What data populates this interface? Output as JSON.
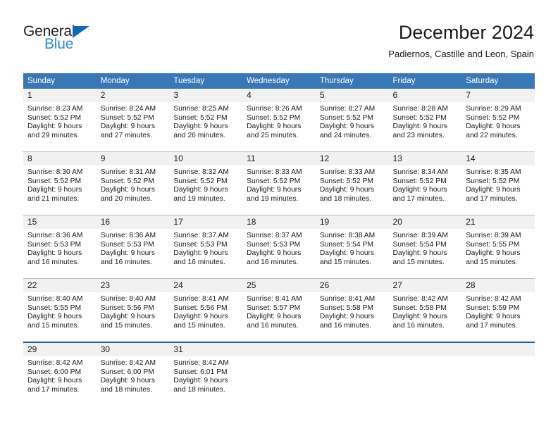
{
  "logo": {
    "word_top": "General",
    "word_bottom": "Blue",
    "triangle_color": "#1167b1",
    "blue_color": "#2e8bd0"
  },
  "header": {
    "title": "December 2024",
    "subtitle": "Padiernos, Castille and Leon, Spain"
  },
  "theme": {
    "header_bg": "#3a77b5",
    "daynum_bg": "#f1f1f1",
    "grid_line": "#bfbfbf",
    "accent_rule": "#1f6099"
  },
  "calendar": {
    "weekday_headers": [
      "Sunday",
      "Monday",
      "Tuesday",
      "Wednesday",
      "Thursday",
      "Friday",
      "Saturday"
    ],
    "weeks": [
      [
        {
          "day": "1",
          "sunrise": "Sunrise: 8:23 AM",
          "sunset": "Sunset: 5:52 PM",
          "daylight_line1": "Daylight: 9 hours",
          "daylight_line2": "and 29 minutes."
        },
        {
          "day": "2",
          "sunrise": "Sunrise: 8:24 AM",
          "sunset": "Sunset: 5:52 PM",
          "daylight_line1": "Daylight: 9 hours",
          "daylight_line2": "and 27 minutes."
        },
        {
          "day": "3",
          "sunrise": "Sunrise: 8:25 AM",
          "sunset": "Sunset: 5:52 PM",
          "daylight_line1": "Daylight: 9 hours",
          "daylight_line2": "and 26 minutes."
        },
        {
          "day": "4",
          "sunrise": "Sunrise: 8:26 AM",
          "sunset": "Sunset: 5:52 PM",
          "daylight_line1": "Daylight: 9 hours",
          "daylight_line2": "and 25 minutes."
        },
        {
          "day": "5",
          "sunrise": "Sunrise: 8:27 AM",
          "sunset": "Sunset: 5:52 PM",
          "daylight_line1": "Daylight: 9 hours",
          "daylight_line2": "and 24 minutes."
        },
        {
          "day": "6",
          "sunrise": "Sunrise: 8:28 AM",
          "sunset": "Sunset: 5:52 PM",
          "daylight_line1": "Daylight: 9 hours",
          "daylight_line2": "and 23 minutes."
        },
        {
          "day": "7",
          "sunrise": "Sunrise: 8:29 AM",
          "sunset": "Sunset: 5:52 PM",
          "daylight_line1": "Daylight: 9 hours",
          "daylight_line2": "and 22 minutes."
        }
      ],
      [
        {
          "day": "8",
          "sunrise": "Sunrise: 8:30 AM",
          "sunset": "Sunset: 5:52 PM",
          "daylight_line1": "Daylight: 9 hours",
          "daylight_line2": "and 21 minutes."
        },
        {
          "day": "9",
          "sunrise": "Sunrise: 8:31 AM",
          "sunset": "Sunset: 5:52 PM",
          "daylight_line1": "Daylight: 9 hours",
          "daylight_line2": "and 20 minutes."
        },
        {
          "day": "10",
          "sunrise": "Sunrise: 8:32 AM",
          "sunset": "Sunset: 5:52 PM",
          "daylight_line1": "Daylight: 9 hours",
          "daylight_line2": "and 19 minutes."
        },
        {
          "day": "11",
          "sunrise": "Sunrise: 8:33 AM",
          "sunset": "Sunset: 5:52 PM",
          "daylight_line1": "Daylight: 9 hours",
          "daylight_line2": "and 19 minutes."
        },
        {
          "day": "12",
          "sunrise": "Sunrise: 8:33 AM",
          "sunset": "Sunset: 5:52 PM",
          "daylight_line1": "Daylight: 9 hours",
          "daylight_line2": "and 18 minutes."
        },
        {
          "day": "13",
          "sunrise": "Sunrise: 8:34 AM",
          "sunset": "Sunset: 5:52 PM",
          "daylight_line1": "Daylight: 9 hours",
          "daylight_line2": "and 17 minutes."
        },
        {
          "day": "14",
          "sunrise": "Sunrise: 8:35 AM",
          "sunset": "Sunset: 5:52 PM",
          "daylight_line1": "Daylight: 9 hours",
          "daylight_line2": "and 17 minutes."
        }
      ],
      [
        {
          "day": "15",
          "sunrise": "Sunrise: 8:36 AM",
          "sunset": "Sunset: 5:53 PM",
          "daylight_line1": "Daylight: 9 hours",
          "daylight_line2": "and 16 minutes."
        },
        {
          "day": "16",
          "sunrise": "Sunrise: 8:36 AM",
          "sunset": "Sunset: 5:53 PM",
          "daylight_line1": "Daylight: 9 hours",
          "daylight_line2": "and 16 minutes."
        },
        {
          "day": "17",
          "sunrise": "Sunrise: 8:37 AM",
          "sunset": "Sunset: 5:53 PM",
          "daylight_line1": "Daylight: 9 hours",
          "daylight_line2": "and 16 minutes."
        },
        {
          "day": "18",
          "sunrise": "Sunrise: 8:37 AM",
          "sunset": "Sunset: 5:53 PM",
          "daylight_line1": "Daylight: 9 hours",
          "daylight_line2": "and 16 minutes."
        },
        {
          "day": "19",
          "sunrise": "Sunrise: 8:38 AM",
          "sunset": "Sunset: 5:54 PM",
          "daylight_line1": "Daylight: 9 hours",
          "daylight_line2": "and 15 minutes."
        },
        {
          "day": "20",
          "sunrise": "Sunrise: 8:39 AM",
          "sunset": "Sunset: 5:54 PM",
          "daylight_line1": "Daylight: 9 hours",
          "daylight_line2": "and 15 minutes."
        },
        {
          "day": "21",
          "sunrise": "Sunrise: 8:39 AM",
          "sunset": "Sunset: 5:55 PM",
          "daylight_line1": "Daylight: 9 hours",
          "daylight_line2": "and 15 minutes."
        }
      ],
      [
        {
          "day": "22",
          "sunrise": "Sunrise: 8:40 AM",
          "sunset": "Sunset: 5:55 PM",
          "daylight_line1": "Daylight: 9 hours",
          "daylight_line2": "and 15 minutes."
        },
        {
          "day": "23",
          "sunrise": "Sunrise: 8:40 AM",
          "sunset": "Sunset: 5:56 PM",
          "daylight_line1": "Daylight: 9 hours",
          "daylight_line2": "and 15 minutes."
        },
        {
          "day": "24",
          "sunrise": "Sunrise: 8:41 AM",
          "sunset": "Sunset: 5:56 PM",
          "daylight_line1": "Daylight: 9 hours",
          "daylight_line2": "and 15 minutes."
        },
        {
          "day": "25",
          "sunrise": "Sunrise: 8:41 AM",
          "sunset": "Sunset: 5:57 PM",
          "daylight_line1": "Daylight: 9 hours",
          "daylight_line2": "and 16 minutes."
        },
        {
          "day": "26",
          "sunrise": "Sunrise: 8:41 AM",
          "sunset": "Sunset: 5:58 PM",
          "daylight_line1": "Daylight: 9 hours",
          "daylight_line2": "and 16 minutes."
        },
        {
          "day": "27",
          "sunrise": "Sunrise: 8:42 AM",
          "sunset": "Sunset: 5:58 PM",
          "daylight_line1": "Daylight: 9 hours",
          "daylight_line2": "and 16 minutes."
        },
        {
          "day": "28",
          "sunrise": "Sunrise: 8:42 AM",
          "sunset": "Sunset: 5:59 PM",
          "daylight_line1": "Daylight: 9 hours",
          "daylight_line2": "and 17 minutes."
        }
      ],
      [
        {
          "day": "29",
          "sunrise": "Sunrise: 8:42 AM",
          "sunset": "Sunset: 6:00 PM",
          "daylight_line1": "Daylight: 9 hours",
          "daylight_line2": "and 17 minutes."
        },
        {
          "day": "30",
          "sunrise": "Sunrise: 8:42 AM",
          "sunset": "Sunset: 6:00 PM",
          "daylight_line1": "Daylight: 9 hours",
          "daylight_line2": "and 18 minutes."
        },
        {
          "day": "31",
          "sunrise": "Sunrise: 8:42 AM",
          "sunset": "Sunset: 6:01 PM",
          "daylight_line1": "Daylight: 9 hours",
          "daylight_line2": "and 18 minutes."
        },
        {
          "day": "",
          "sunrise": "",
          "sunset": "",
          "daylight_line1": "",
          "daylight_line2": ""
        },
        {
          "day": "",
          "sunrise": "",
          "sunset": "",
          "daylight_line1": "",
          "daylight_line2": ""
        },
        {
          "day": "",
          "sunrise": "",
          "sunset": "",
          "daylight_line1": "",
          "daylight_line2": ""
        },
        {
          "day": "",
          "sunrise": "",
          "sunset": "",
          "daylight_line1": "",
          "daylight_line2": ""
        }
      ]
    ]
  }
}
